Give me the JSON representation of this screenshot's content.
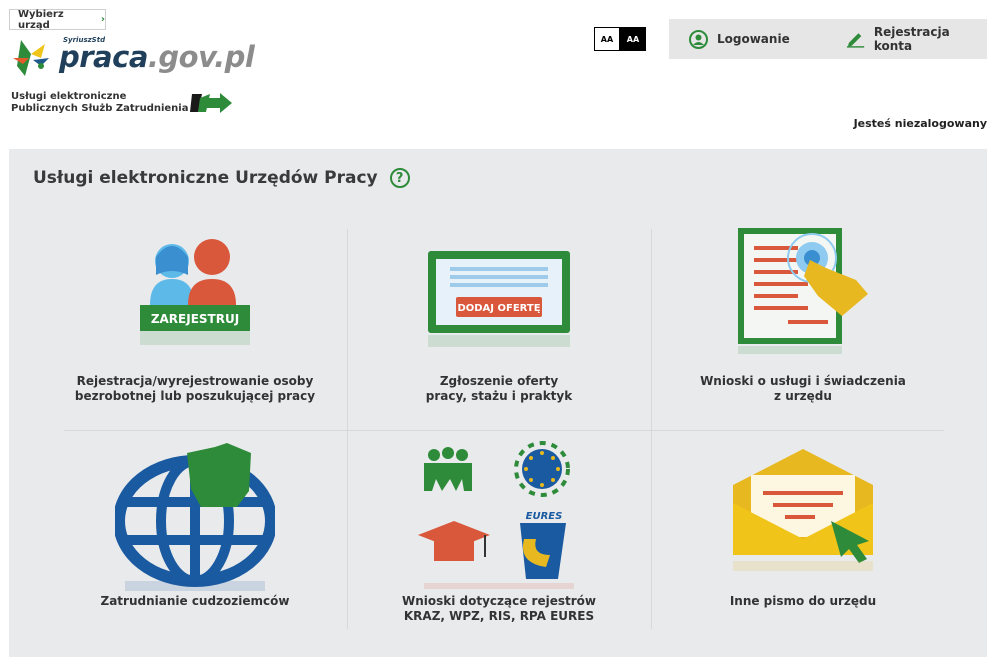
{
  "header": {
    "office_button": "Wybierz urząd",
    "logo_super": "SyriuszStd",
    "logo_part1": "praca",
    "logo_part2": ".gov.pl",
    "subtitle_line1": "Usługi elektroniczne",
    "subtitle_line2": "Publicznych Służb Zatrudnienia",
    "contrast_normal": "AA",
    "contrast_high": "AA",
    "login_label": "Logowanie",
    "register_label": "Rejestracja konta",
    "status": "Jesteś niezalogowany"
  },
  "main": {
    "title": "Usługi elektroniczne Urzędów Pracy",
    "help": "?",
    "tiles": [
      {
        "line1": "Rejestracja/wyrejestrowanie osoby",
        "line2": "bezrobotnej lub poszukującej pracy",
        "badge": "ZAREJESTRUJ"
      },
      {
        "line1": "Zgłoszenie oferty",
        "line2": "pracy, stażu i praktyk",
        "badge": "DODAJ OFERTĘ"
      },
      {
        "line1": "Wnioski o usługi i świadczenia",
        "line2": "z urzędu"
      },
      {
        "line1": "Zatrudnianie cudzoziemców",
        "line2": ""
      },
      {
        "line1": "Wnioski dotyczące rejestrów",
        "line2": "KRAZ, WPZ, RIS, RPA EURES",
        "badge": "EURES"
      },
      {
        "line1": "Inne pismo do urzędu",
        "line2": ""
      }
    ]
  },
  "colors": {
    "green": "#2e8b3a",
    "red": "#d9573b",
    "blue": "#3a8fd0",
    "yellow": "#e8b820",
    "navy": "#1a5aa0"
  }
}
